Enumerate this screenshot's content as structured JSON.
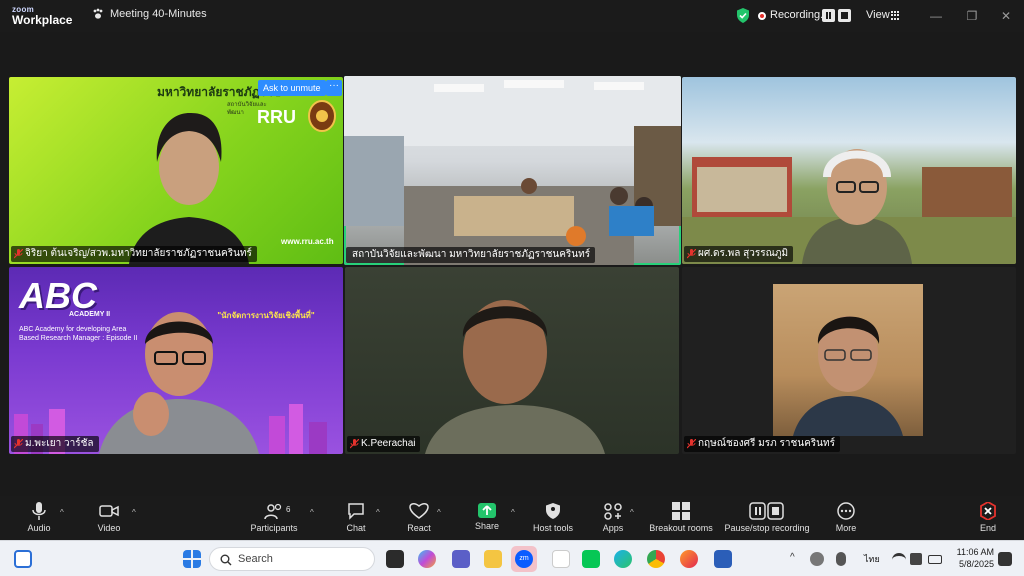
{
  "titlebar": {
    "brand_line1": "zoom",
    "brand_line2": "Workplace",
    "meeting_title": "Meeting 40-Minutes",
    "recording_label": "Recording...",
    "view_label": "View"
  },
  "tiles": [
    {
      "name": "จิริยา ต้นเจริญ/สวพ.มหาวิทยาลัยราชภัฏราชนครินทร์",
      "banner": "มหาวิทยาลัยราชภัฏราช",
      "sub": "สถาบันวิจัยและพัฒนา",
      "badge": "RRU",
      "url": "www.rru.ac.th",
      "muted": true,
      "ask_unmute": "Ask to unmute",
      "more": "···"
    },
    {
      "name": "สถาบันวิจัยและพัฒนา มหาวิทยาลัยราชภัฏราชนครินทร์",
      "muted": false,
      "active": true
    },
    {
      "name": "ผศ.ดร.พล สุวรรณภูมิ",
      "muted": true
    },
    {
      "name": "ม.พะเยา วาร์ชัล",
      "muted": true,
      "logo": "ABC",
      "academy": "ACADEMY II",
      "desc": "ABC Academy for developing Area Based Research Manager : Episode II",
      "headline": "\"นักจัดการงานวิจัยเชิงพื้นที่\""
    },
    {
      "name": "K.Peerachai",
      "muted": true
    },
    {
      "name": "กฤษณ์ชองศรี มรภ ราชนครินทร์",
      "muted": true
    }
  ],
  "toolbar": {
    "items": [
      {
        "label": "Audio",
        "icon": "microphone-icon"
      },
      {
        "label": "Video",
        "icon": "camera-icon"
      },
      {
        "label": "Participants",
        "icon": "participants-icon",
        "count": "6"
      },
      {
        "label": "Chat",
        "icon": "chat-icon"
      },
      {
        "label": "React",
        "icon": "heart-icon"
      },
      {
        "label": "Share",
        "icon": "share-icon"
      },
      {
        "label": "Host tools",
        "icon": "shield-icon"
      },
      {
        "label": "Apps",
        "icon": "apps-icon"
      },
      {
        "label": "Breakout rooms",
        "icon": "breakout-icon"
      },
      {
        "label": "Pause/stop recording",
        "icon": "record-controls-icon"
      },
      {
        "label": "More",
        "icon": "more-icon"
      },
      {
        "label": "End",
        "icon": "end-icon"
      }
    ]
  },
  "taskbar": {
    "search_placeholder": "Search",
    "language": "ไทย",
    "time": "11:06 AM",
    "date": "5/8/2025"
  },
  "colors": {
    "accent_blue": "#2d8cff",
    "share_green": "#23c46b",
    "active_speaker": "#28d07a",
    "end_red": "#e5322d"
  }
}
